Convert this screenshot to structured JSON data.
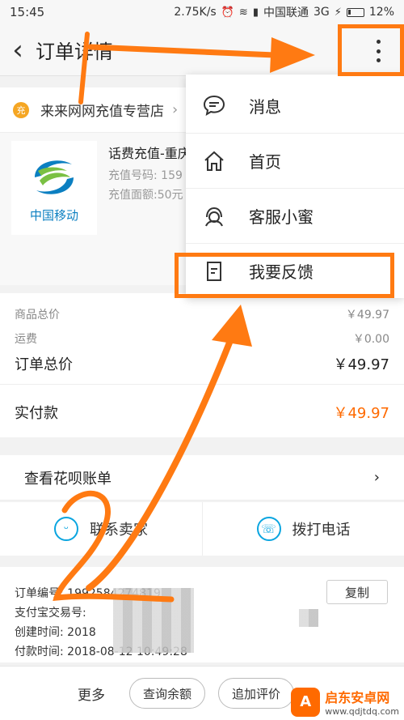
{
  "status": {
    "time": "15:45",
    "speed": "2.75K/s",
    "carrier": "中国联通",
    "network": "3G",
    "battery": "12%"
  },
  "nav": {
    "title": "订单详情"
  },
  "shop": {
    "icon_text": "充",
    "name": "来来网网充值专营店"
  },
  "product": {
    "logo_text": "中国移动",
    "title": "话费充值-重庆",
    "recharge_no": "充值号码: 159",
    "face_value": "充值面额:50元"
  },
  "prices": {
    "goods_label": "商品总价",
    "goods_value": "￥49.97",
    "freight_label": "运费",
    "freight_value": "￥0.00",
    "total_label": "订单总价",
    "total_value": "￥49.97",
    "paid_label": "实付款",
    "paid_value": "￥49.97"
  },
  "huabei": {
    "label": "查看花呗账单"
  },
  "contact": {
    "seller": "联系卖家",
    "phone": "拨打电话"
  },
  "order": {
    "order_no": "订单编号: 1992584274819",
    "copy": "复制",
    "alipay_no": "支付宝交易号:",
    "created": "创建时间: 2018",
    "paid": "付款时间: 2018-08-12 10:49:28"
  },
  "bottom": {
    "more": "更多",
    "balance": "查询余额",
    "review": "追加评价"
  },
  "menu": {
    "items": [
      {
        "label": "消息",
        "icon": "chat-bubble-icon"
      },
      {
        "label": "首页",
        "icon": "home-icon"
      },
      {
        "label": "客服小蜜",
        "icon": "customer-service-icon"
      },
      {
        "label": "我要反馈",
        "icon": "feedback-icon"
      }
    ]
  },
  "annotation": {
    "step_number": "2",
    "color": "#ff7a12"
  },
  "watermark": {
    "cn": "启东安卓网",
    "en": "www.qdjtdq.com"
  }
}
